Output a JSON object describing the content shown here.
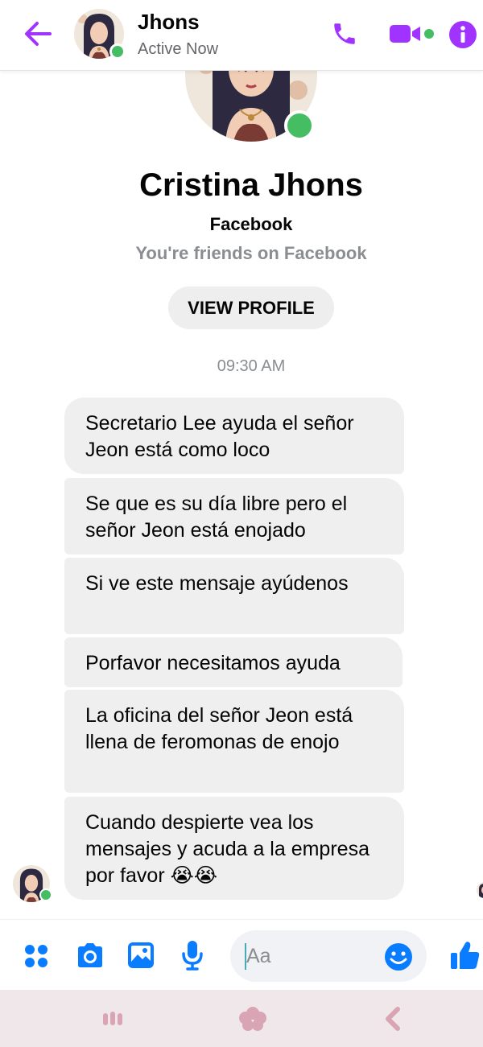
{
  "header": {
    "back_icon": "arrow-left-icon",
    "contact_name": "Jhons",
    "status": "Active Now",
    "call_icon": "phone-icon",
    "video_icon": "video-camera-icon",
    "info_icon": "info-icon",
    "accent_color": "#a033ff",
    "online_color": "#45bd62"
  },
  "profile": {
    "full_name": "Cristina Jhons",
    "platform": "Facebook",
    "relationship": "You're friends on Facebook",
    "view_profile_label": "VIEW PROFILE"
  },
  "conversation": {
    "timestamp": "09:30 AM",
    "messages": [
      {
        "text": "Secretario Lee ayuda el señor Jeon está como loco"
      },
      {
        "text": "Se que es su día libre pero el señor Jeon está enojado"
      },
      {
        "text": "Si ve este mensaje ayúdenos"
      },
      {
        "text": "Porfavor necesitamos ayuda"
      },
      {
        "text": "La oficina del señor Jeon está llena de feromonas de enojo"
      },
      {
        "text": "Cuando despierte vea los mensajes y acuda a la empresa por favor 😭😭"
      }
    ],
    "bubble_color": "#efefef"
  },
  "composer": {
    "menu_icon": "four-dots-icon",
    "camera_icon": "camera-icon",
    "gallery_icon": "image-icon",
    "mic_icon": "microphone-icon",
    "placeholder": "Aa",
    "emoji_icon": "smiley-icon",
    "like_icon": "thumbs-up-icon",
    "icon_color": "#0a7cff"
  },
  "system_nav": {
    "recents_icon": "recent-apps-icon",
    "home_icon": "home-flower-icon",
    "back_icon": "chevron-left-icon",
    "color": "#d9a5b4"
  }
}
